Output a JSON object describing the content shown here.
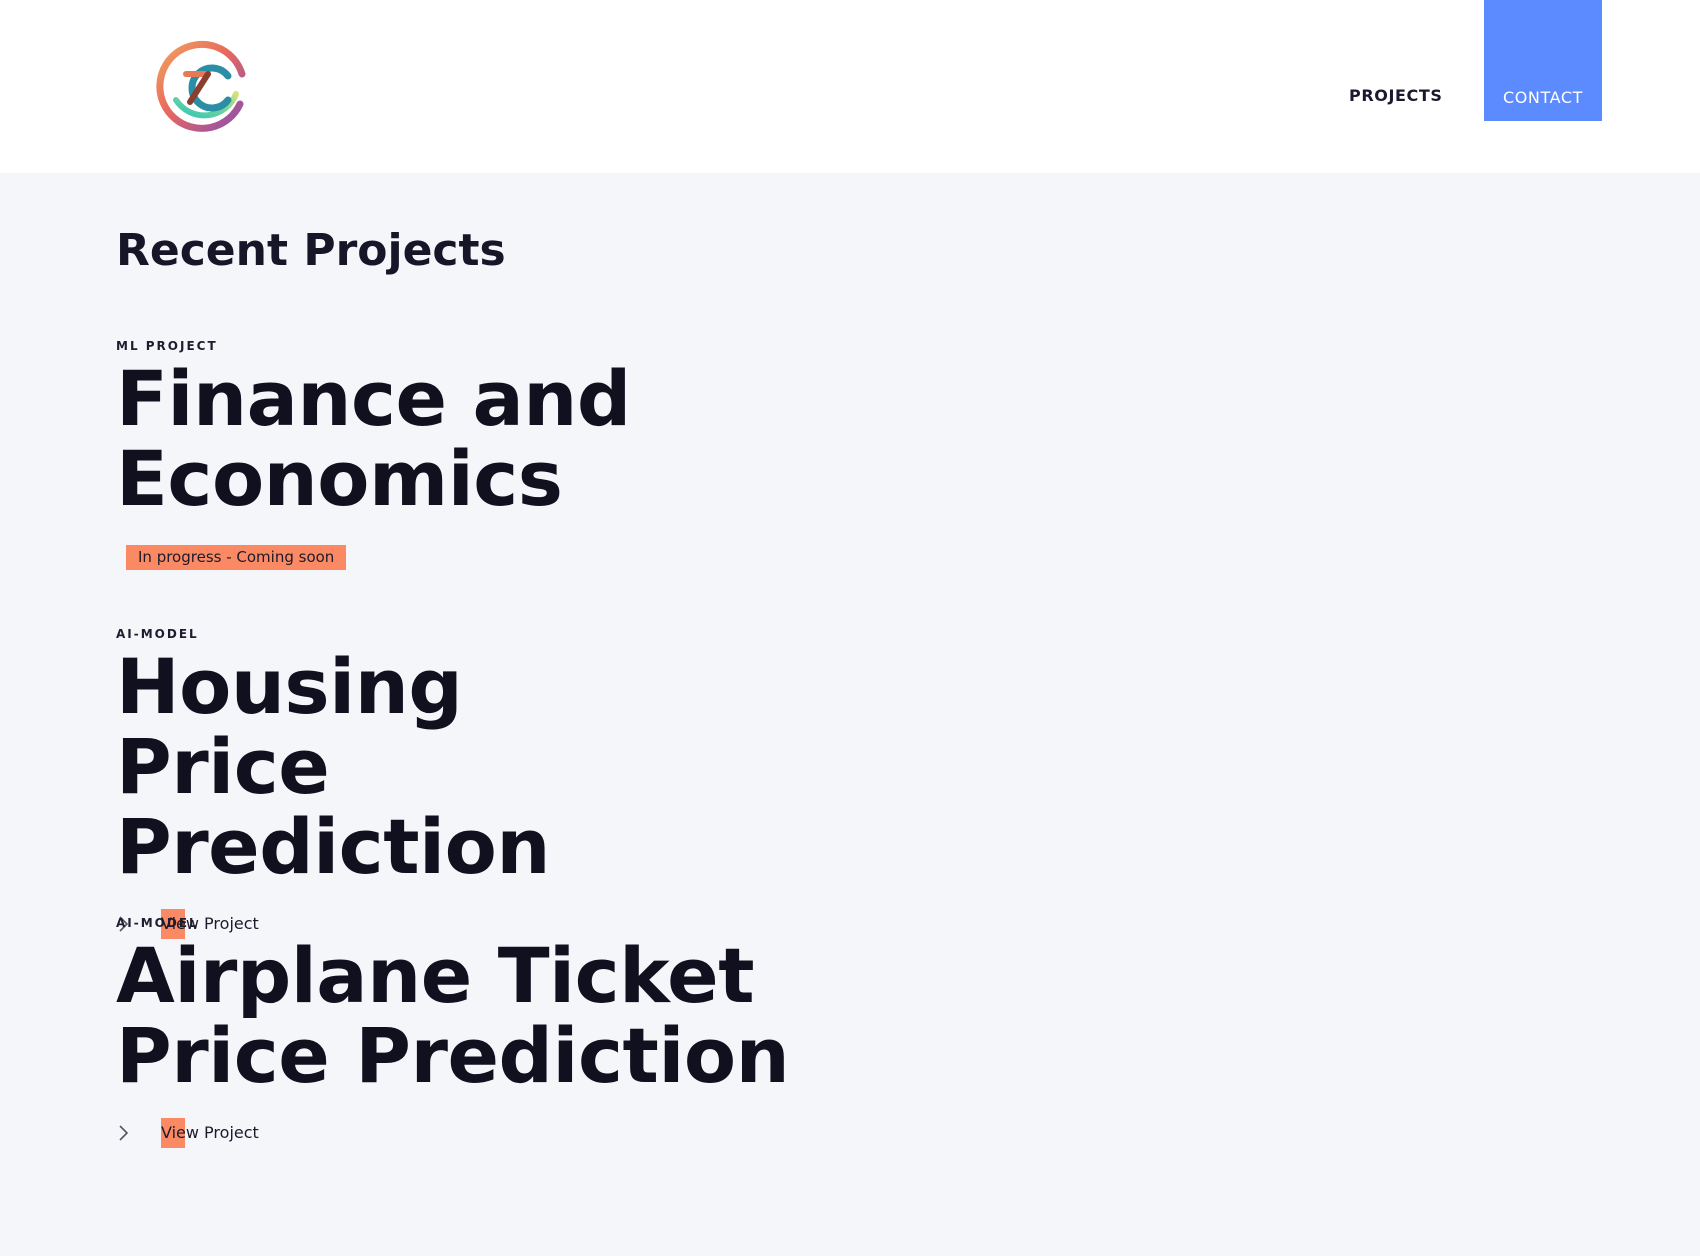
{
  "header": {
    "logo_icon": "cc-monogram-logo-icon",
    "nav": {
      "projects_label": "PROJECTS",
      "contact_label": "CONTACT"
    },
    "accent_color": "#5b8bff"
  },
  "main": {
    "section_title": "Recent Projects",
    "highlight_color": "#fb8a64",
    "projects": [
      {
        "category": "ML PROJECT",
        "title": "Finance and Economics",
        "status": "In progress - Coming soon"
      },
      {
        "category": "AI-MODEL",
        "title": "Housing Price Prediction",
        "link_label": "View Project",
        "link_icon": "chevron-right-icon"
      },
      {
        "category": "AI-MODEL",
        "title": "Airplane Ticket Price Prediction",
        "link_label": "View Project",
        "link_icon": "chevron-right-icon"
      }
    ]
  }
}
